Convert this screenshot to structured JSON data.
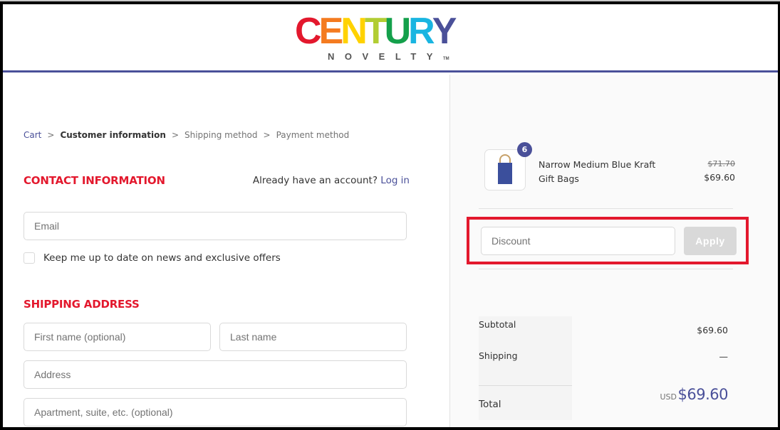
{
  "brand": {
    "letters": [
      {
        "char": "C",
        "color": "#e3182d"
      },
      {
        "char": "E",
        "color": "#f47b20"
      },
      {
        "char": "N",
        "color": "#ffd200"
      },
      {
        "char": "T",
        "color": "#b2cd33"
      },
      {
        "char": "U",
        "color": "#14a04b"
      },
      {
        "char": "R",
        "color": "#19b5e1"
      },
      {
        "char": "Y",
        "color": "#4a5099"
      }
    ],
    "name": "CENTURY",
    "subtitle": "NOVELTY",
    "trademark": "TM"
  },
  "colors": {
    "accent": "#4a5099",
    "section_title": "#e3182d",
    "highlight": "#e3182d"
  },
  "breadcrumb": [
    {
      "label": "Cart",
      "state": "link"
    },
    {
      "label": "Customer information",
      "state": "current"
    },
    {
      "label": "Shipping method",
      "state": "upcoming"
    },
    {
      "label": "Payment method",
      "state": "upcoming"
    }
  ],
  "breadcrumb_separator": ">",
  "contact": {
    "title": "CONTACT INFORMATION",
    "account_prompt": "Already have an account?",
    "login_label": "Log in",
    "email_placeholder": "Email",
    "email_value": "",
    "newsletter_label": "Keep me up to date on news and exclusive offers",
    "newsletter_checked": false
  },
  "shipping": {
    "title": "SHIPPING ADDRESS",
    "first_name_placeholder": "First name (optional)",
    "last_name_placeholder": "Last name",
    "address_placeholder": "Address",
    "apartment_placeholder": "Apartment, suite, etc. (optional)"
  },
  "order": {
    "product": {
      "name": "Narrow Medium Blue Kraft Gift Bags",
      "quantity": "6",
      "original_price": "$71.70",
      "price": "$69.60",
      "image": "blue-gift-bag"
    },
    "discount": {
      "placeholder": "Discount",
      "value": "",
      "apply_label": "Apply"
    },
    "totals": {
      "subtotal_label": "Subtotal",
      "subtotal_value": "$69.60",
      "shipping_label": "Shipping",
      "shipping_value": "—",
      "total_label": "Total",
      "currency": "USD",
      "total_value": "$69.60"
    }
  }
}
